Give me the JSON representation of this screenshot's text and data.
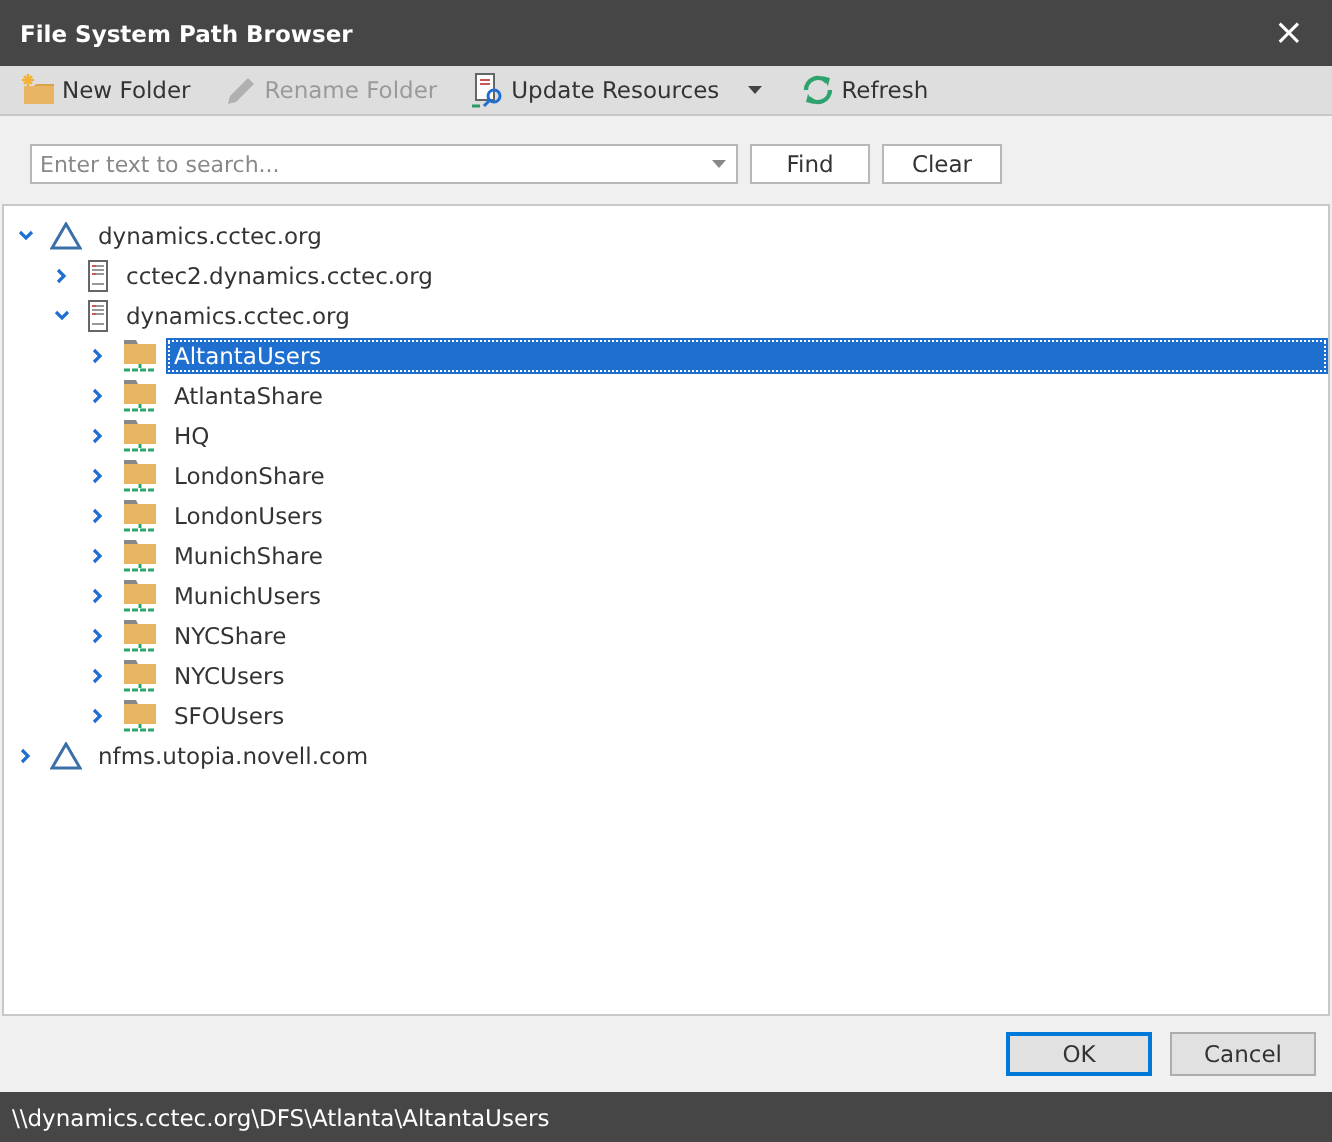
{
  "window": {
    "title": "File System Path Browser",
    "close": "×"
  },
  "toolbar": [
    {
      "kind": "new-folder",
      "label": "New Folder",
      "disabled": false
    },
    {
      "kind": "rename",
      "label": "Rename Folder",
      "disabled": true
    },
    {
      "kind": "update",
      "label": "Update Resources",
      "disabled": false
    },
    {
      "kind": "refresh",
      "label": "Refresh",
      "disabled": false
    }
  ],
  "search": {
    "placeholder": "Enter text to search...",
    "find": "Find",
    "clear": "Clear"
  },
  "tree": [
    {
      "kind": "domain",
      "label": "dynamics.cctec.org",
      "expanded": true,
      "selected": false,
      "children": [
        {
          "kind": "server",
          "label": "cctec2.dynamics.cctec.org",
          "expanded": false,
          "selected": false
        },
        {
          "kind": "server",
          "label": "dynamics.cctec.org",
          "expanded": true,
          "selected": false,
          "children": [
            {
              "kind": "share",
              "label": "AltantaUsers",
              "expanded": false,
              "selected": true
            },
            {
              "kind": "share",
              "label": "AtlantaShare",
              "expanded": false,
              "selected": false
            },
            {
              "kind": "share",
              "label": "HQ",
              "expanded": false,
              "selected": false
            },
            {
              "kind": "share",
              "label": "LondonShare",
              "expanded": false,
              "selected": false
            },
            {
              "kind": "share",
              "label": "LondonUsers",
              "expanded": false,
              "selected": false
            },
            {
              "kind": "share",
              "label": "MunichShare",
              "expanded": false,
              "selected": false
            },
            {
              "kind": "share",
              "label": "MunichUsers",
              "expanded": false,
              "selected": false
            },
            {
              "kind": "share",
              "label": "NYCShare",
              "expanded": false,
              "selected": false
            },
            {
              "kind": "share",
              "label": "NYCUsers",
              "expanded": false,
              "selected": false
            },
            {
              "kind": "share",
              "label": "SFOUsers",
              "expanded": false,
              "selected": false
            }
          ]
        }
      ]
    },
    {
      "kind": "domain",
      "label": "nfms.utopia.novell.com",
      "expanded": false,
      "selected": false
    }
  ],
  "buttons": [
    {
      "label": "OK",
      "default": true
    },
    {
      "label": "Cancel",
      "default": false
    }
  ],
  "status_bar": "\\\\dynamics.cctec.org\\DFS\\Atlanta\\AltantaUsers"
}
